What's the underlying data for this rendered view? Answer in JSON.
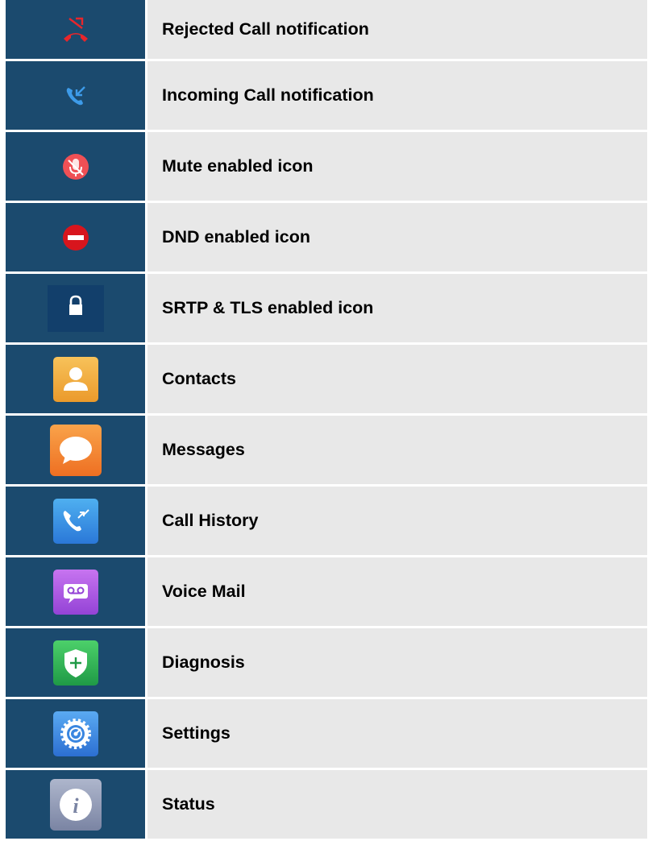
{
  "rows": [
    {
      "icon": "rejected-call-icon",
      "label": "Rejected Call notification"
    },
    {
      "icon": "incoming-call-icon",
      "label": "Incoming Call notification"
    },
    {
      "icon": "mute-enabled-icon",
      "label": "Mute enabled icon"
    },
    {
      "icon": "dnd-enabled-icon",
      "label": "DND enabled icon"
    },
    {
      "icon": "lock-icon",
      "label": "SRTP & TLS enabled icon"
    },
    {
      "icon": "contacts-icon",
      "label": "Contacts"
    },
    {
      "icon": "messages-icon",
      "label": "Messages"
    },
    {
      "icon": "call-history-icon",
      "label": "Call History"
    },
    {
      "icon": "voice-mail-icon",
      "label": "Voice Mail"
    },
    {
      "icon": "diagnosis-icon",
      "label": "Diagnosis"
    },
    {
      "icon": "settings-icon",
      "label": "Settings"
    },
    {
      "icon": "status-icon",
      "label": "Status"
    }
  ],
  "colors": {
    "icon_cell_bg": "#1b4a6e",
    "label_cell_bg": "#e8e8e8",
    "reject_red": "#e8262b",
    "incoming_blue": "#3d9be9"
  }
}
